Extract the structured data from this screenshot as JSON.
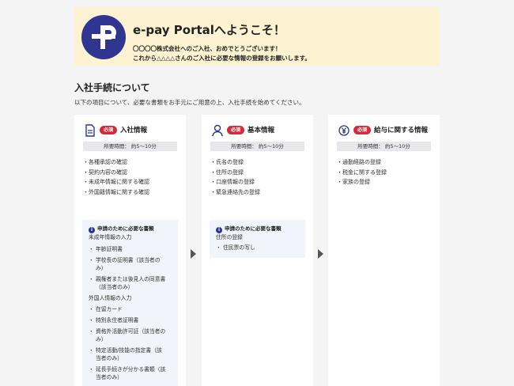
{
  "banner": {
    "title": "e-pay Portalへようこそ！",
    "line1": "〇〇〇〇株式会社へのご入社、おめでとうございます！",
    "line2": "これから△△△△さんのご入社に必要な情報の登録をお願いします。"
  },
  "section": {
    "title": "入社手続について",
    "desc": "以下の項目について、必要な書類をお手元にご用意の上、入社手続を始めてください。"
  },
  "cards": [
    {
      "icon": "document-icon",
      "badge": "必須",
      "title": "入社情報",
      "time": "所要時間： 約5〜10分",
      "items": [
        "各種承認の確認",
        "契約内容の確認",
        "未成年情報に関する確認",
        "外国籍情報に関する確認"
      ],
      "info": {
        "head": "申請のために必要な書類",
        "g1": "未成年情報の入力",
        "g1_items": [
          "・ 年齢証明書",
          "・ 学校長の証明書（該当者の",
          "み）",
          "・ 親権者または後見人の同意書",
          "（該当者のみ）"
        ],
        "g2": "外国人情報の入力",
        "g2_items": [
          "・ 在留カード",
          "・ 特別永住者証明書",
          "・ 資格外活動許可証（該当者の",
          "み）",
          "・ 特定活動/技能の指定書（該",
          "当者のみ）",
          "・ 延長手続きが分かる書類（該",
          "当者のみ）"
        ]
      }
    },
    {
      "icon": "person-icon",
      "badge": "必須",
      "title": "基本情報",
      "time": "所要時間： 約5〜10分",
      "items": [
        "氏名の登録",
        "住所の登録",
        "口座情報の登録",
        "緊急連絡先の登録"
      ],
      "info": {
        "head": "申請のために必要な書類",
        "g1": "住所の登録",
        "g1_items": [
          "・ 住民票の写し"
        ]
      }
    },
    {
      "icon": "yen-icon",
      "badge": "必須",
      "title": "給与に関する情報",
      "time": "所要時間： 約5〜10分",
      "items": [
        "通勤経路の登録",
        "税金に関する登録",
        "家族の登録"
      ]
    }
  ],
  "colors": {
    "brand": "#2f3590",
    "badge": "#d42b3a",
    "banner_bg": "#fdf3d2"
  }
}
